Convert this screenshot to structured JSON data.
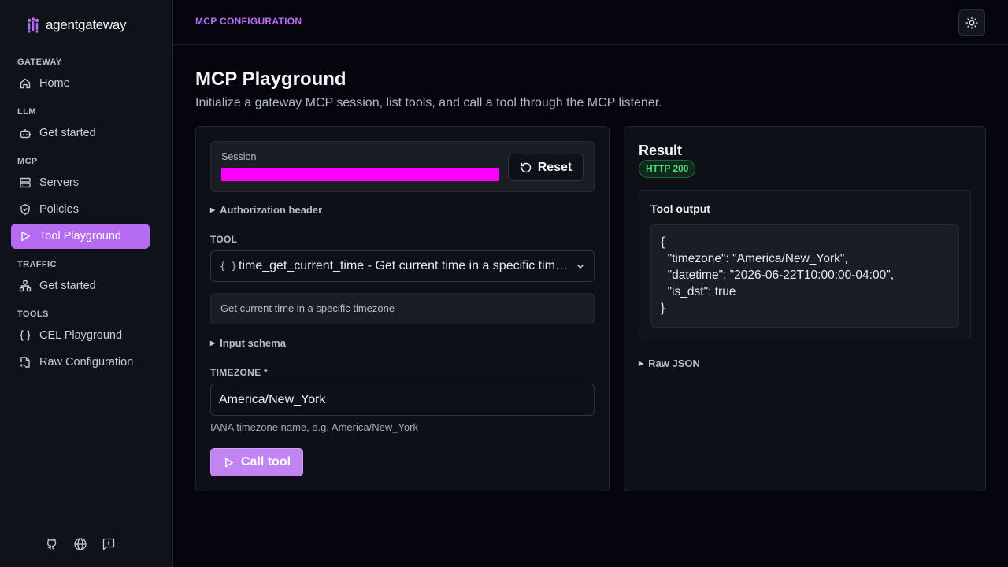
{
  "brand": {
    "name": "agentgateway"
  },
  "sidebar": {
    "groups": [
      {
        "title": "GATEWAY",
        "items": [
          {
            "label": "Home",
            "icon": "home-icon"
          }
        ]
      },
      {
        "title": "LLM",
        "items": [
          {
            "label": "Get started",
            "icon": "bot-icon"
          }
        ]
      },
      {
        "title": "MCP",
        "items": [
          {
            "label": "Servers",
            "icon": "server-icon"
          },
          {
            "label": "Policies",
            "icon": "shield-icon"
          },
          {
            "label": "Tool Playground",
            "icon": "play-icon",
            "active": true
          }
        ]
      },
      {
        "title": "TRAFFIC",
        "items": [
          {
            "label": "Get started",
            "icon": "network-icon"
          }
        ]
      },
      {
        "title": "TOOLS",
        "items": [
          {
            "label": "CEL Playground",
            "icon": "braces-icon"
          },
          {
            "label": "Raw Configuration",
            "icon": "file-code-icon"
          }
        ]
      }
    ],
    "footer_icons": [
      "github-icon",
      "globe-icon",
      "feedback-icon"
    ]
  },
  "header": {
    "breadcrumb": "MCP CONFIGURATION",
    "theme_icon": "sun-icon"
  },
  "main": {
    "title": "MCP Playground",
    "subtitle": "Initialize a gateway MCP session, list tools, and call a tool through the MCP listener."
  },
  "form": {
    "session_label": "Session",
    "session_bar_color": "#ff00ff",
    "reset_label": "Reset",
    "auth_header_label": "Authorization header",
    "tool_label": "TOOL",
    "tool_icon": "{ }",
    "tool_selected": "time_get_current_time - Get current time in a specific timezone",
    "tool_description": "Get current time in a specific timezone",
    "input_schema_label": "Input schema",
    "timezone_label": "TIMEZONE *",
    "timezone_value": "America/New_York",
    "timezone_help": "IANA timezone name, e.g. America/New_York",
    "call_label": "Call tool"
  },
  "result": {
    "title": "Result",
    "status": "HTTP 200",
    "output_title": "Tool output",
    "output_code": "{\n  \"timezone\": \"America/New_York\",\n  \"datetime\": \"2026-06-22T10:00:00-04:00\",\n  \"is_dst\": true\n}",
    "raw_json_label": "Raw JSON"
  },
  "colors": {
    "accent": "#b56cf0",
    "success": "#4ade80",
    "background": "#05060d"
  }
}
